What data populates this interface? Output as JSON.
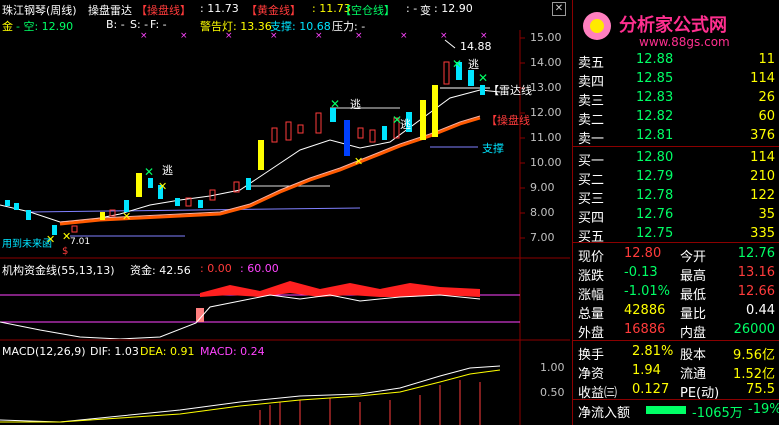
{
  "header": {
    "title": "珠江钢琴(周线)",
    "indicator_name": "操盘雷达",
    "line1_label": "【操盘线】",
    "line1_value": ": 11.73",
    "line2_label": "【黄金线】",
    "line2_value": ": 11.73",
    "line3_label": "【空仓线】",
    "line3_value": ": -",
    "change_label": "变",
    "change_value": ": 12.90",
    "gold_label": "金",
    "empty_label": "- 空: 12.90",
    "b_label": "B: -",
    "s_label": "S: -",
    "f_label": "F: -",
    "warn_label": "警告灯: 13.36",
    "support_label": "支撑: 10.68",
    "pressure_label": "压力: -"
  },
  "price_axis": [
    "15.00",
    "14.00",
    "13.00",
    "12.00",
    "11.00",
    "10.00",
    "9.00",
    "8.00",
    "7.00"
  ],
  "annotations": {
    "high": "14.88",
    "escape": "逃",
    "radar": "【雷达线",
    "op_line": "【操盘线",
    "support": "支撑",
    "low": "7.01",
    "future": "用到未来函",
    "buy_mark": "$"
  },
  "fund_panel": {
    "title": "机构资金线(55,13,13)",
    "fund_label": "资金: 42.56",
    "v1": ": 0.00",
    "v2": ": 60.00"
  },
  "macd_panel": {
    "title": "MACD(12,26,9)",
    "dif": "DIF: 1.03",
    "dea": "DEA: 0.91",
    "macd": "MACD: 0.24",
    "axis": [
      "1.00",
      "0.50"
    ]
  },
  "logo": {
    "name": "分析家公式网",
    "url": "www.88gs.com"
  },
  "order_book": {
    "asks": [
      {
        "label": "卖五",
        "price": "12.88",
        "vol": "11"
      },
      {
        "label": "卖四",
        "price": "12.85",
        "vol": "114"
      },
      {
        "label": "卖三",
        "price": "12.83",
        "vol": "26"
      },
      {
        "label": "卖二",
        "price": "12.82",
        "vol": "60"
      },
      {
        "label": "卖一",
        "price": "12.81",
        "vol": "376"
      }
    ],
    "bids": [
      {
        "label": "买一",
        "price": "12.80",
        "vol": "114"
      },
      {
        "label": "买二",
        "price": "12.79",
        "vol": "210"
      },
      {
        "label": "买三",
        "price": "12.78",
        "vol": "122"
      },
      {
        "label": "买四",
        "price": "12.76",
        "vol": "35"
      },
      {
        "label": "买五",
        "price": "12.75",
        "vol": "335"
      }
    ]
  },
  "stats": [
    {
      "l1": "现价",
      "v1": "12.80",
      "l2": "今开",
      "v2": "12.76"
    },
    {
      "l1": "涨跌",
      "v1": "-0.13",
      "l2": "最高",
      "v2": "13.16"
    },
    {
      "l1": "涨幅",
      "v1": "-1.01%",
      "l2": "最低",
      "v2": "12.66"
    },
    {
      "l1": "总量",
      "v1": "42886",
      "l2": "量比",
      "v2": "0.44"
    },
    {
      "l1": "外盘",
      "v1": "16886",
      "l2": "内盘",
      "v2": "26000"
    }
  ],
  "stats2": [
    {
      "l1": "换手",
      "v1": "2.81%",
      "l2": "股本",
      "v2": "9.56亿"
    },
    {
      "l1": "净资",
      "v1": "1.94",
      "l2": "流通",
      "v2": "1.52亿"
    },
    {
      "l1": "收益㈢",
      "v1": "0.127",
      "l2": "PE(动)",
      "v2": "75.5"
    }
  ],
  "net_inflow": {
    "label": "净流入额",
    "value": "-1065万",
    "pct": "-19%"
  },
  "colors": {
    "up": "#ff3b3b",
    "down": "#00ff66",
    "grid": "#8b0000",
    "radar": "#ff8c1a"
  }
}
